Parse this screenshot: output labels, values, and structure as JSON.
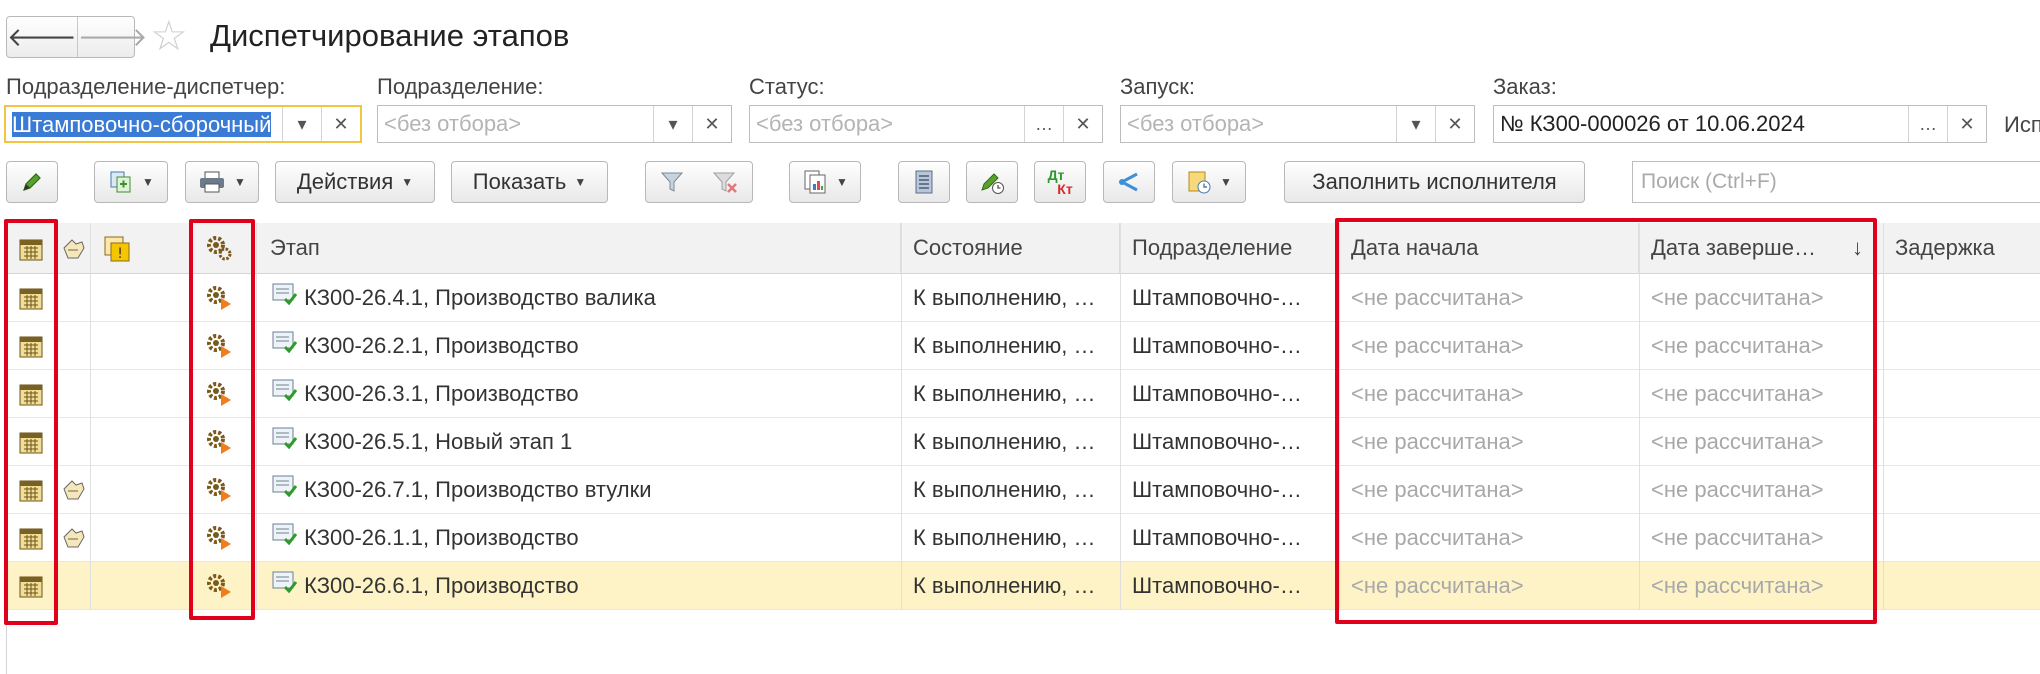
{
  "window": {
    "title": "Диспетчирование этапов"
  },
  "filters": {
    "dispatcher": {
      "label": "Подразделение-диспетчер:",
      "value": "Штамповочно-сборочный"
    },
    "division": {
      "label": "Подразделение:",
      "placeholder": "<без отбора>"
    },
    "status": {
      "label": "Статус:",
      "placeholder": "<без отбора>"
    },
    "launch": {
      "label": "Запуск:",
      "placeholder": "<без отбора>"
    },
    "order": {
      "label": "Заказ:",
      "value": "№ КЗ00-000026 от 10.06.2024"
    },
    "executor_label_cut": "Исп"
  },
  "toolbar": {
    "actions_label": "Действия",
    "show_label": "Показать",
    "fill_executor_label": "Заполнить исполнителя",
    "dt_kt_top": "Дт",
    "dt_kt_bottom": "Кт",
    "search_placeholder": "Поиск (Ctrl+F)"
  },
  "table": {
    "columns": {
      "stage": "Этап",
      "state": "Состояние",
      "division": "Подразделение",
      "start": "Дата начала",
      "end": "Дата заверше…",
      "delay": "Задержка"
    },
    "sort_indicator": "↓",
    "rows": [
      {
        "stage": "КЗ00-26.4.1, Производство валика",
        "state": "К выполнению, …",
        "division": "Штамповочно-…",
        "start": "<не рассчитана>",
        "end": "<не рассчитана>",
        "flag": false
      },
      {
        "stage": "КЗ00-26.2.1, Производство",
        "state": "К выполнению, …",
        "division": "Штамповочно-…",
        "start": "<не рассчитана>",
        "end": "<не рассчитана>",
        "flag": false
      },
      {
        "stage": "КЗ00-26.3.1, Производство",
        "state": "К выполнению, …",
        "division": "Штамповочно-…",
        "start": "<не рассчитана>",
        "end": "<не рассчитана>",
        "flag": false
      },
      {
        "stage": "КЗ00-26.5.1, Новый этап 1",
        "state": "К выполнению, …",
        "division": "Штамповочно-…",
        "start": "<не рассчитана>",
        "end": "<не рассчитана>",
        "flag": false
      },
      {
        "stage": "КЗ00-26.7.1, Производство втулки",
        "state": "К выполнению, …",
        "division": "Штамповочно-…",
        "start": "<не рассчитана>",
        "end": "<не рассчитана>",
        "flag": true
      },
      {
        "stage": "КЗ00-26.1.1, Производство",
        "state": "К выполнению, …",
        "division": "Штамповочно-…",
        "start": "<не рассчитана>",
        "end": "<не рассчитана>",
        "flag": true
      },
      {
        "stage": "КЗ00-26.6.1, Производство",
        "state": "К выполнению, …",
        "division": "Штамповочно-…",
        "start": "<не рассчитана>",
        "end": "<не рассчитана>",
        "flag": false
      }
    ]
  },
  "icons": {
    "calendar": "calendar-icon",
    "gears": "gears-play-icon",
    "doc_check": "document-check-icon",
    "hand": "hand-pointer-icon",
    "warning_copy": "warning-copy-icon"
  },
  "colors": {
    "highlight_red": "#e0001b",
    "current_row": "#fdf3c6",
    "focus_border": "#f4c542"
  }
}
